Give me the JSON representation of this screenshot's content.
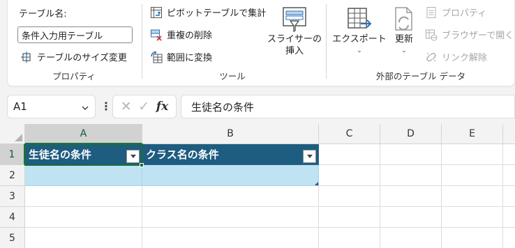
{
  "ribbon": {
    "properties": {
      "table_name_label": "テーブル名:",
      "table_name_value": "条件入力用テーブル",
      "resize_label": "テーブルのサイズ変更",
      "group_label": "プロパティ"
    },
    "tools": {
      "pivot_label": "ピボットテーブルで集計",
      "remove_dup_label": "重複の削除",
      "convert_label": "範囲に変換",
      "slicer_line1": "スライサーの",
      "slicer_line2": "挿入",
      "group_label": "ツール"
    },
    "external": {
      "export_label": "エクスポート",
      "refresh_label": "更新",
      "properties_label": "プロパティ",
      "open_browser_label": "ブラウザーで開く",
      "unlink_label": "リンク解除",
      "group_label": "外部のテーブル データ"
    }
  },
  "formula_bar": {
    "name_box": "A1",
    "formula": "生徒名の条件"
  },
  "sheet": {
    "columns": [
      "A",
      "B",
      "C",
      "D",
      "E"
    ],
    "rows": [
      "1",
      "2",
      "3",
      "4",
      "5"
    ],
    "table_headers": [
      "生徒名の条件",
      "クラス名の条件"
    ]
  },
  "colors": {
    "table_header": "#1e5c80",
    "table_row": "#bfe3f3",
    "selection": "#1a6e3c"
  }
}
